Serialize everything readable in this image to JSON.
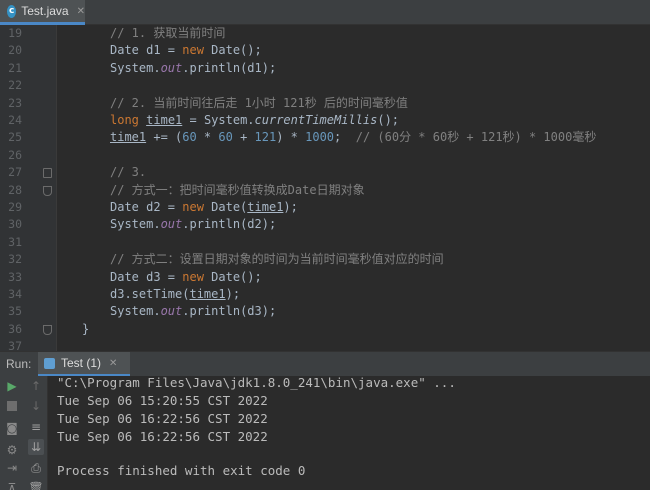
{
  "tab": {
    "title": "Test.java",
    "icon": "java-class-icon"
  },
  "code_lines": [
    {
      "n": "19",
      "html": "<span class=\"cm\">// 1. 获取当前时间</span>"
    },
    {
      "n": "20",
      "html": "Date d1 = <span class=\"kw\">new</span> Date();"
    },
    {
      "n": "21",
      "html": "System.<span class=\"fld\">out</span>.println(d1);"
    },
    {
      "n": "22",
      "html": ""
    },
    {
      "n": "23",
      "html": "<span class=\"cm\">// 2. 当前时间往后走 1小时 121秒 后的时间毫秒值</span>"
    },
    {
      "n": "24",
      "html": "<span class=\"kw\">long</span> <span class=\"uvar\">time1</span> = System.<span class=\"st\">currentTimeMillis</span>();"
    },
    {
      "n": "25",
      "html": "<span class=\"uvar\">time1</span> += (<span class=\"num\">60</span> * <span class=\"num\">60</span> + <span class=\"num\">121</span>) * <span class=\"num\">1000</span>;  <span class=\"cm\">// (60分 * 60秒 + 121秒) * 1000毫秒</span>"
    },
    {
      "n": "26",
      "html": ""
    },
    {
      "n": "27",
      "html": "<span class=\"cm\">// 3.</span>"
    },
    {
      "n": "28",
      "html": "<span class=\"cm\">// 方式一：把时间毫秒值转换成Date日期对象</span>"
    },
    {
      "n": "29",
      "html": "Date d2 = <span class=\"kw\">new</span> Date(<span class=\"uvar\">time1</span>);"
    },
    {
      "n": "30",
      "html": "System.<span class=\"fld\">out</span>.println(d2);"
    },
    {
      "n": "31",
      "html": ""
    },
    {
      "n": "32",
      "html": "<span class=\"cm\">// 方式二：设置日期对象的时间为当前时间毫秒值对应的时间</span>"
    },
    {
      "n": "33",
      "html": "Date d3 = <span class=\"kw\">new</span> Date();"
    },
    {
      "n": "34",
      "html": "d3.setTime(<span class=\"uvar\">time1</span>);"
    },
    {
      "n": "35",
      "html": "System.<span class=\"fld\">out</span>.println(d3);"
    },
    {
      "n": "36",
      "html": "}"
    },
    {
      "n": "37",
      "html": ""
    }
  ],
  "run": {
    "label": "Run:",
    "tab_title": "Test (1)",
    "console": [
      "\"C:\\Program Files\\Java\\jdk1.8.0_241\\bin\\java.exe\" ...",
      "Tue Sep 06 15:20:55 CST 2022",
      "Tue Sep 06 16:22:56 CST 2022",
      "Tue Sep 06 16:22:56 CST 2022",
      "",
      "Process finished with exit code 0"
    ]
  },
  "colors": {
    "accent": "#4a88c7",
    "run_green": "#59a869",
    "stop_gray": "#6e6e6e"
  }
}
